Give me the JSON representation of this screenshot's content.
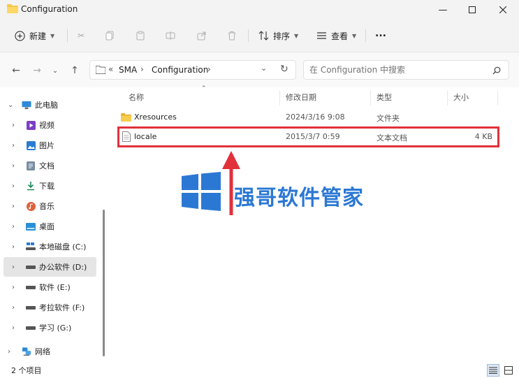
{
  "window": {
    "title": "Configuration"
  },
  "toolbar": {
    "new_label": "新建",
    "sort_label": "排序",
    "view_label": "查看",
    "more_label": "..."
  },
  "nav": {
    "path": [
      "SMA",
      "Configuration"
    ],
    "prefix": "«",
    "search_placeholder": "在 Configuration 中搜索"
  },
  "sidebar": {
    "items": [
      {
        "label": "此电脑",
        "icon": "computer-icon",
        "expanded": true
      },
      {
        "label": "视频",
        "icon": "video-folder-icon"
      },
      {
        "label": "图片",
        "icon": "pictures-folder-icon"
      },
      {
        "label": "文档",
        "icon": "documents-folder-icon"
      },
      {
        "label": "下载",
        "icon": "downloads-folder-icon"
      },
      {
        "label": "音乐",
        "icon": "music-folder-icon"
      },
      {
        "label": "桌面",
        "icon": "desktop-folder-icon"
      },
      {
        "label": "本地磁盘 (C:)",
        "icon": "windows-drive-icon"
      },
      {
        "label": "办公软件 (D:)",
        "icon": "drive-icon",
        "selected": true
      },
      {
        "label": "软件 (E:)",
        "icon": "drive-icon"
      },
      {
        "label": "考拉软件 (F:)",
        "icon": "drive-icon"
      },
      {
        "label": "学习 (G:)",
        "icon": "drive-icon"
      },
      {
        "label": "网络",
        "icon": "network-icon"
      }
    ]
  },
  "columns": {
    "name": "名称",
    "modified": "修改日期",
    "type": "类型",
    "size": "大小"
  },
  "files": [
    {
      "name": "Xresources",
      "modified": "2024/3/16 9:08",
      "type": "文件夹",
      "size": "",
      "icon": "folder-icon"
    },
    {
      "name": "locale",
      "modified": "2015/3/7 0:59",
      "type": "文本文档",
      "size": "4 KB",
      "icon": "text-file-icon"
    }
  ],
  "status": {
    "item_count": "2 个项目"
  },
  "watermark": {
    "text": "强哥软件管家"
  },
  "colors": {
    "accent": "#2b78d4",
    "highlight": "#e1313b",
    "folder": "#f4c84a"
  }
}
